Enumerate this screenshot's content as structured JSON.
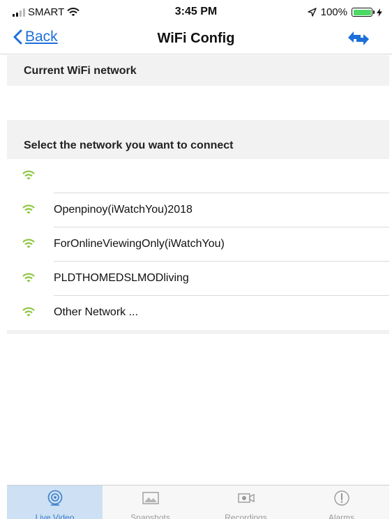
{
  "status_bar": {
    "carrier": "SMART",
    "time": "3:45 PM",
    "battery_percent": "100%",
    "battery_level": 1.0,
    "battery_color": "#4cd964"
  },
  "nav": {
    "back_label": "Back",
    "title": "WiFi Config",
    "refresh_icon": "refresh-arrows-icon",
    "accent_color": "#1e6fd9"
  },
  "current_section": {
    "title": "Current WiFi network"
  },
  "select_section": {
    "title": "Select the network you want to connect"
  },
  "networks": [
    {
      "name": "",
      "icon": "wifi-icon"
    },
    {
      "name": "Openpinoy(iWatchYou)2018",
      "icon": "wifi-icon"
    },
    {
      "name": "ForOnlineViewingOnly(iWatchYou)",
      "icon": "wifi-icon"
    },
    {
      "name": "PLDTHOMEDSLMODliving",
      "icon": "wifi-icon"
    },
    {
      "name": "Other Network ...",
      "icon": "wifi-icon"
    }
  ],
  "wifi_icon_color": "#8dc63f",
  "tabs": [
    {
      "label": "Live Video",
      "icon": "webcam-icon",
      "active": true
    },
    {
      "label": "Snapshots",
      "icon": "image-icon",
      "active": false
    },
    {
      "label": "Recordings",
      "icon": "video-camera-icon",
      "active": false
    },
    {
      "label": "Alarms",
      "icon": "alert-icon",
      "active": false
    }
  ]
}
